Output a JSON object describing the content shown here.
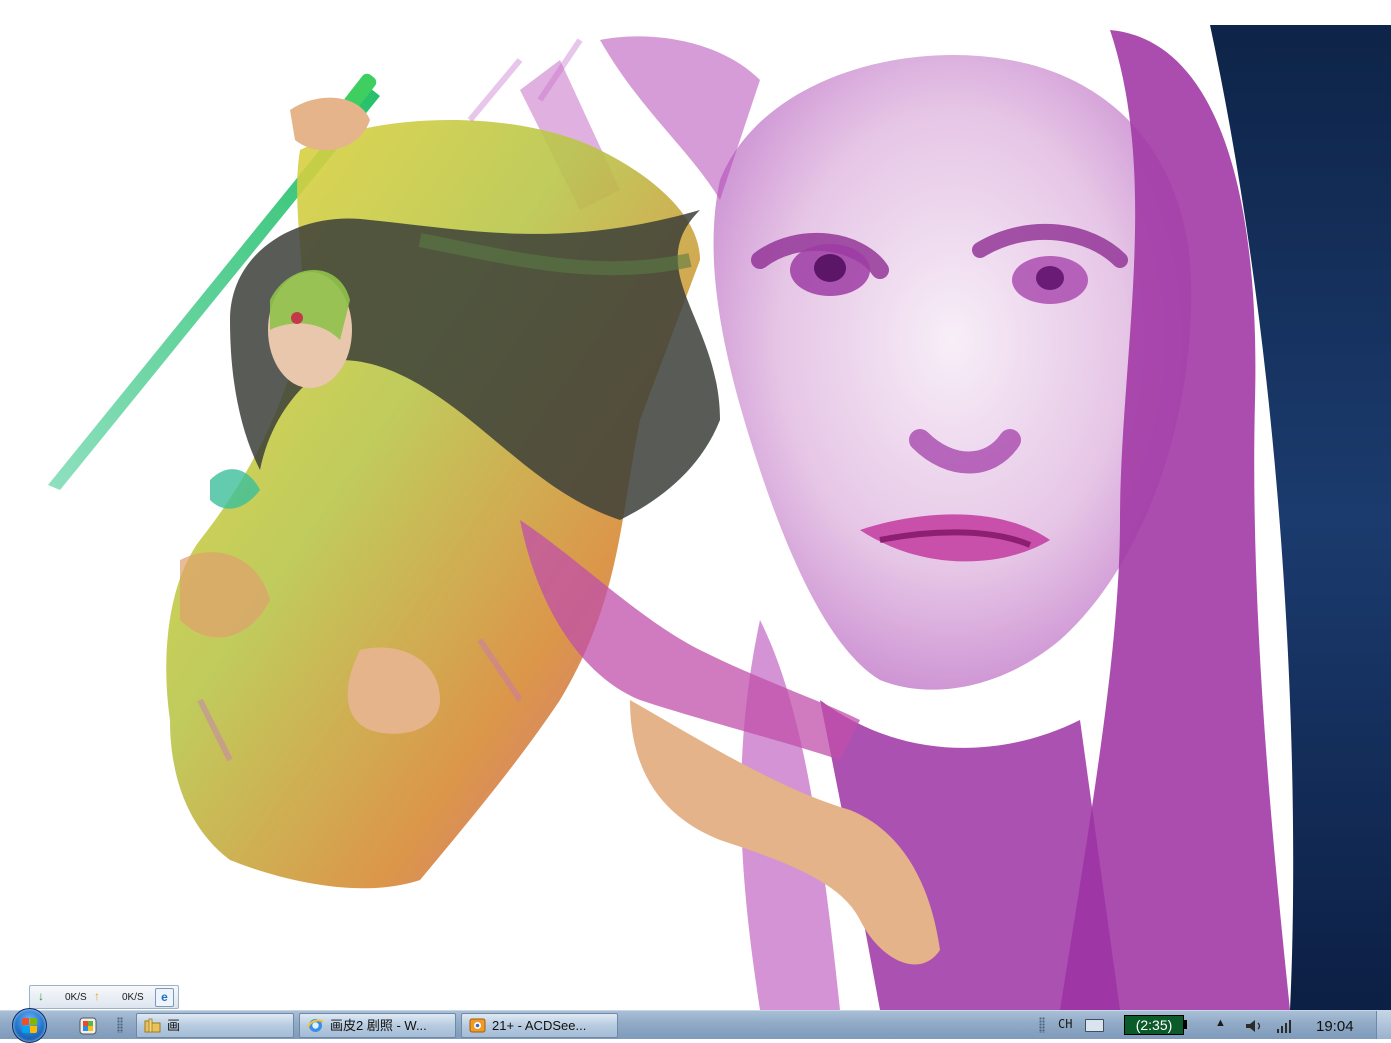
{
  "network_meter": {
    "download_speed": "0K/S",
    "upload_speed": "0K/S",
    "download_icon": "down-arrow-icon",
    "upload_icon": "up-arrow-icon",
    "browser_icon": "ie-icon"
  },
  "taskbar": {
    "start_icon": "windows-start-icon",
    "quick_launch": [
      {
        "icon": "media-center-icon"
      },
      {
        "icon": "folder-icon",
        "label": "画"
      }
    ],
    "tasks": [
      {
        "icon": "ie-icon",
        "label": "画皮2 剧照 - W..."
      },
      {
        "icon": "acdsee-icon",
        "label": "21+ - ACDSee..."
      }
    ],
    "tray": {
      "ime": "CH",
      "keyboard_icon": "keyboard-icon",
      "battery_time": "(2:35)",
      "show_hidden_icon": "chevron-up-icon",
      "volume_icon": "speaker-icon",
      "signal_icon": "signal-icon",
      "clock": "19:04"
    }
  },
  "colors": {
    "taskbar": "#90aac6",
    "battery_bg": "#0b5a2a",
    "wallpaper_purple": "#a23aa6",
    "wallpaper_dark": "#0f2a55"
  }
}
